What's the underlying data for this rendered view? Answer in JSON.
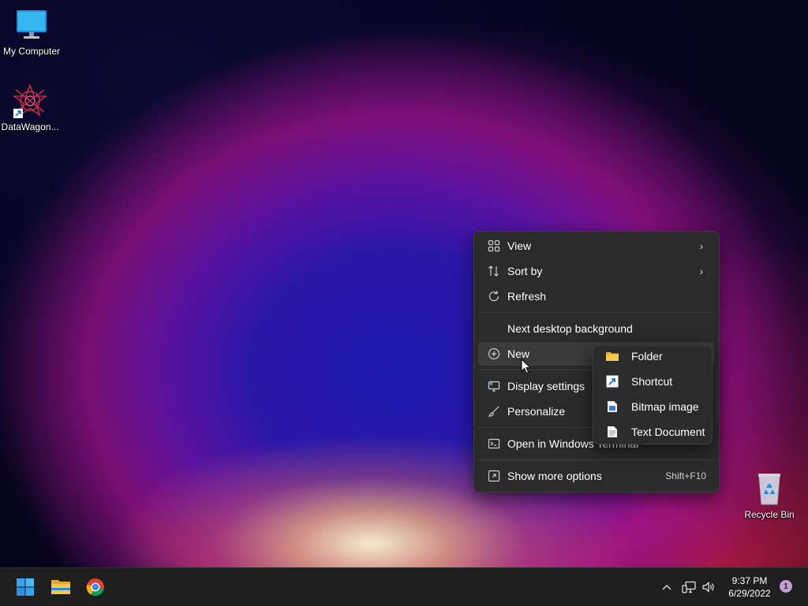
{
  "desktop": {
    "icons": [
      {
        "label": "My Computer"
      },
      {
        "label": "DataWagon..."
      },
      {
        "label": "Recycle Bin"
      }
    ]
  },
  "context_menu": {
    "items": [
      {
        "label": "View",
        "icon": "grid-icon",
        "submenu": true
      },
      {
        "label": "Sort by",
        "icon": "sort-icon",
        "submenu": true
      },
      {
        "label": "Refresh",
        "icon": "refresh-icon"
      },
      {
        "label": "Next desktop background"
      },
      {
        "label": "New",
        "icon": "plus-circle-icon"
      },
      {
        "label": "Display settings",
        "icon": "display-icon"
      },
      {
        "label": "Personalize",
        "icon": "brush-icon"
      },
      {
        "label": "Open in Windows Terminal",
        "icon": "terminal-icon"
      },
      {
        "label": "Show more options",
        "icon": "expand-icon",
        "shortcut": "Shift+F10"
      }
    ]
  },
  "new_submenu": {
    "items": [
      {
        "label": "Folder",
        "icon": "folder-icon"
      },
      {
        "label": "Shortcut",
        "icon": "shortcut-icon"
      },
      {
        "label": "Bitmap image",
        "icon": "bitmap-icon"
      },
      {
        "label": "Text Document",
        "icon": "text-document-icon"
      }
    ]
  },
  "taskbar": {
    "time": "9:37 PM",
    "date": "6/29/2022",
    "notification_count": "1",
    "apps": [
      {
        "name": "start-button"
      },
      {
        "name": "file-explorer"
      },
      {
        "name": "chrome"
      }
    ]
  },
  "colors": {
    "menu_bg": "#2b2b2b",
    "taskbar_bg": "#1f1f1f",
    "accent": "#0078d4"
  }
}
